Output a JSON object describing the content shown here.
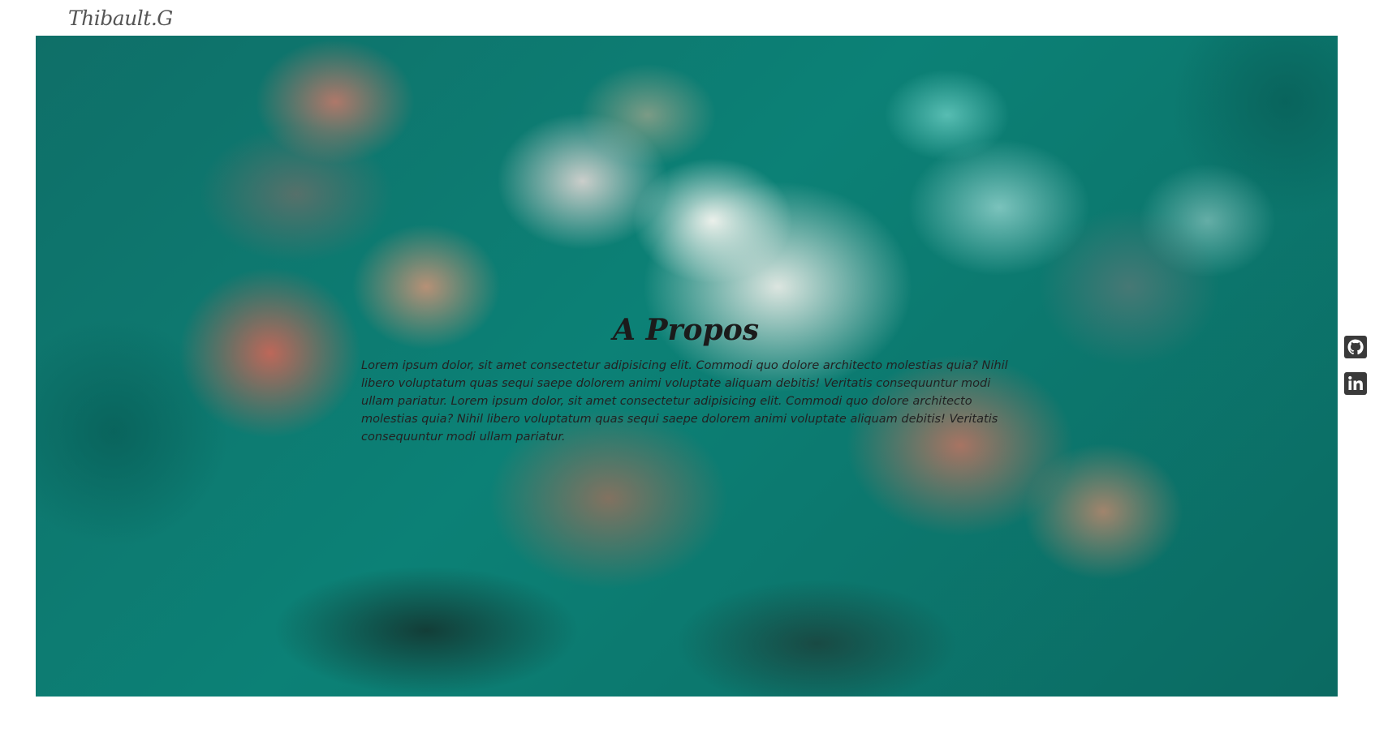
{
  "header": {
    "brand": "Thibault.G"
  },
  "about": {
    "title": "A Propos",
    "text": "Lorem ipsum dolor, sit amet consectetur adipisicing elit. Commodi quo dolore architecto molestias quia? Nihil libero voluptatum quas sequi saepe dolorem animi voluptate aliquam debitis! Veritatis consequuntur modi ullam pariatur. Lorem ipsum dolor, sit amet consectetur adipisicing elit. Commodi quo dolore architecto molestias quia? Nihil libero voluptatum quas sequi saepe dolorem animi voluptate aliquam debitis! Veritatis consequuntur modi ullam pariatur."
  },
  "social": [
    {
      "icon": "github-icon"
    },
    {
      "icon": "linkedin-icon"
    }
  ],
  "colors": {
    "icon": "#3a3a3a",
    "hero_base": "#0e6d66",
    "brand_text": "#555555"
  }
}
